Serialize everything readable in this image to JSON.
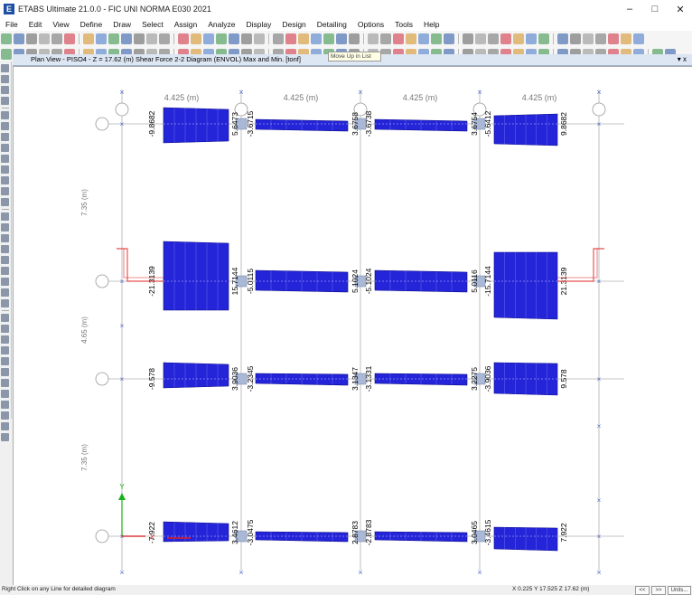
{
  "window": {
    "title": "ETABS Ultimate 21.0.0 - FIC UNI NORMA E030 2021",
    "app_icon_letter": "E",
    "minimize": "–",
    "maximize": "□",
    "close": "✕"
  },
  "menu": [
    "File",
    "Edit",
    "View",
    "Define",
    "Draw",
    "Select",
    "Assign",
    "Analyze",
    "Display",
    "Design",
    "Detailing",
    "Options",
    "Tools",
    "Help"
  ],
  "view": {
    "title": "Plan View - PISO4 - Z = 17.62 (m)   Shear Force 2-2 Diagram   (ENVOL) Max and Min. [tonf]",
    "tooltip": "Move Up in List",
    "pin": "▾ x"
  },
  "plan": {
    "span_labels": [
      "4.425 (m)",
      "4.425 (m)",
      "4.425 (m)",
      "4.425 (m)"
    ],
    "vertical_labels": [
      "7.35 (m)",
      "4.65 (m)",
      "7.35 (m)"
    ],
    "rows": [
      {
        "labels": [
          "-9.8682",
          "5.6473",
          "-3.6715",
          "3.6758",
          "-3.6738",
          "3.6754",
          "-5.6412",
          "9.8682"
        ]
      },
      {
        "labels": [
          "-21.3139",
          "15.7144",
          "-5.0115",
          "5.1024",
          "-5.1024",
          "5.0116",
          "-15.7144",
          "21.3139"
        ]
      },
      {
        "labels": [
          "-9.578",
          "3.9036",
          "-3.2345",
          "3.1347",
          "-3.1331",
          "3.2275",
          "-3.9036",
          "9.578"
        ]
      },
      {
        "labels": [
          "-7.922",
          "3.4612",
          "-3.0475",
          "2.8783",
          "-2.8783",
          "3.0465",
          "-3.4615",
          "7.922"
        ]
      }
    ],
    "axis_y_label": "Y",
    "axis_x_label": "X",
    "colors": {
      "diagram_fill": "#2424d8",
      "diagram_edge": "#0a0a8a",
      "grid": "#b0b0b0",
      "column": "#a9b8d6",
      "beam_support": "#e02020"
    }
  },
  "status": {
    "message": "Right Click on any Line for detailed diagram",
    "coords": "X 0.225  Y 17.525  Z 17.62 (m)",
    "prev": "<<",
    "next": ">>",
    "units": "Units..."
  }
}
